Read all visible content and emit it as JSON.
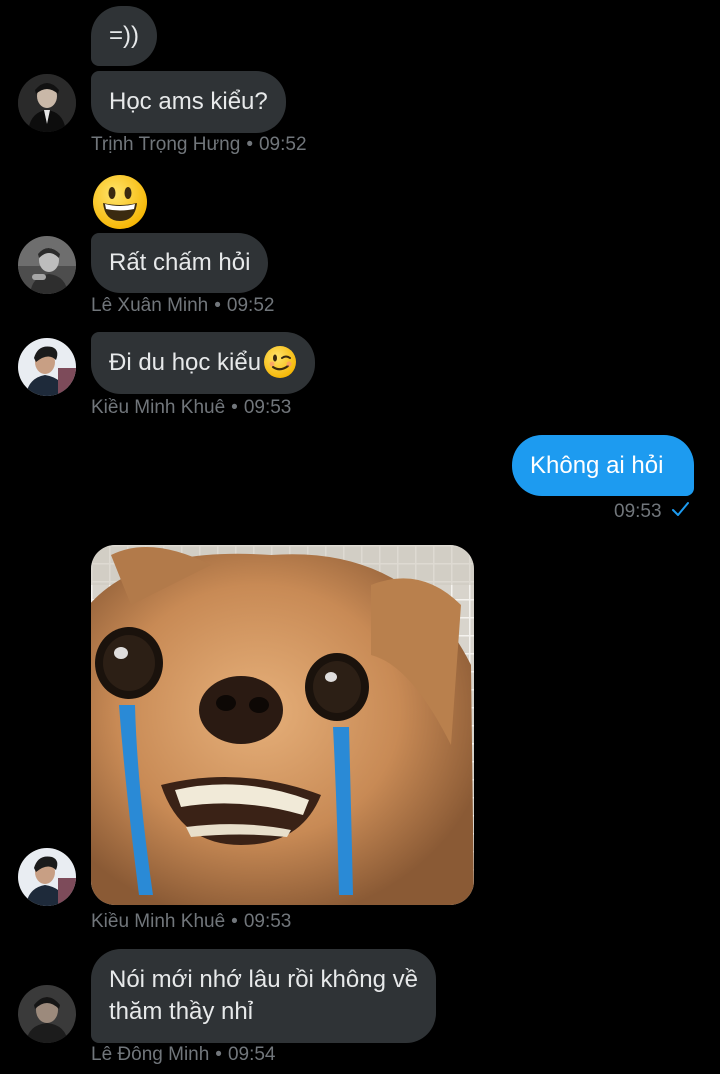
{
  "messages": [
    {
      "text": "=))"
    },
    {
      "text": "Học ams kiểu?",
      "sender": "Trịnh Trọng Hưng",
      "time": "09:52"
    },
    {
      "emoji": "grinning-face"
    },
    {
      "text": "Rất chấm hỏi",
      "sender": "Lê Xuân Minh",
      "time": "09:52"
    },
    {
      "text": "Đi du học kiểu",
      "emoji": "winking-face",
      "sender": "Kiều Minh Khuê",
      "time": "09:53"
    },
    {
      "text": "Không ai hỏi",
      "time": "09:53",
      "status": "sent-check",
      "mine": true
    },
    {
      "media": "crying-chihuahua-meme",
      "sender": "Kiều Minh Khuê",
      "time": "09:53"
    },
    {
      "line1": "Nói mới nhớ lâu rồi không về",
      "line2": "thăm thầy nhỉ",
      "sender": "Lê Đông Minh",
      "time": "09:54"
    }
  ],
  "colors": {
    "background": "#000000",
    "bubble_incoming": "#2f3336",
    "bubble_outgoing": "#1d9bf0",
    "meta_text": "#71767b",
    "check": "#1d9bf0"
  },
  "separator": "•"
}
